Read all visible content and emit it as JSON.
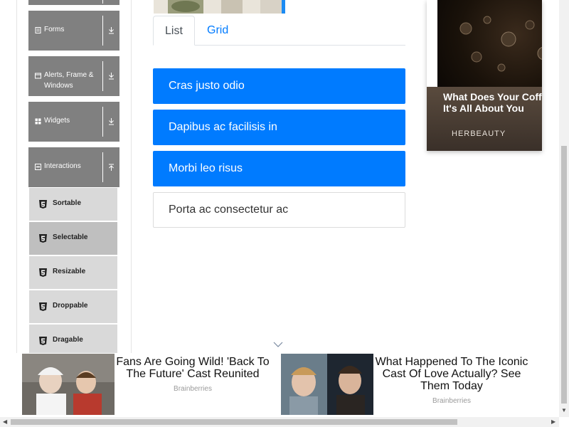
{
  "sidebar": {
    "groups": [
      {
        "label": "Forms",
        "icon": "form-icon"
      },
      {
        "label_line1": "Alerts, Frame &",
        "label_line2": "Windows",
        "icon": "window-icon"
      },
      {
        "label": "Widgets",
        "icon": "widgets-grid-icon"
      },
      {
        "label": "Interactions",
        "icon": "collapse-square-icon"
      }
    ],
    "items": [
      {
        "label": "Sortable"
      },
      {
        "label": "Selectable",
        "active": true
      },
      {
        "label": "Resizable"
      },
      {
        "label": "Droppable"
      },
      {
        "label": "Dragable"
      }
    ]
  },
  "tabs": {
    "list": "List",
    "grid": "Grid",
    "active": "List"
  },
  "list_items": [
    {
      "text": "Cras justo odio",
      "selected": true
    },
    {
      "text": "Dapibus ac facilisis in",
      "selected": true
    },
    {
      "text": "Morbi leo risus",
      "selected": true
    },
    {
      "text": "Porta ac consectetur ac",
      "selected": false
    }
  ],
  "ad_right": {
    "headline_line1": "What Does Your Coffee O",
    "headline_line2": "It's All About You",
    "source": "HERBEAUTY"
  },
  "bottom_ads": [
    {
      "title": "Fans Are Going Wild! 'Back To The Future' Cast Reunited",
      "source": "Brainberries"
    },
    {
      "title": "What Happened To The Iconic Cast Of Love Actually? See Them Today",
      "source": "Brainberries"
    }
  ],
  "colors": {
    "accent": "#007bff",
    "sidebar_group": "#808080",
    "sidebar_item": "#d9d9d9",
    "sidebar_item_active": "#bfbfbf"
  }
}
